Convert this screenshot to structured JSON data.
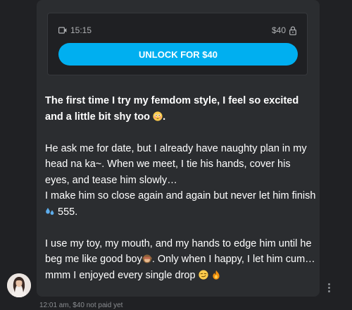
{
  "locked_media": {
    "duration": "15:15",
    "price": "$40",
    "unlock_label": "UNLOCK FOR $40",
    "accent_color": "#00aff0",
    "media_icon": "video-icon",
    "lock_icon": "lock-icon"
  },
  "message": {
    "para1": "The first time I try my femdom style, I feel so excited and a little bit shy too",
    "para1_tail": ".",
    "para2_line1": "He ask me for date, but I already have naughty plan in my head na ka~. When we meet, I tie his hands, cover his eyes, and tease him slowly…",
    "para2_line2": "I make him so close again and again but never let him finish",
    "para2_tail": "555.",
    "para3": "I use my toy, my mouth, and my hands to edge him until he beg me like good boy",
    "para3_mid": ". Only when I happy, I let him cum… mmm I enjoyed every single drop",
    "emojis": [
      "flushed-face-emoji",
      "sweat-droplets-emoji",
      "see-no-evil-monkey-emoji",
      "smirking-face-emoji",
      "fire-emoji"
    ]
  },
  "footer": {
    "time": "12:01 am,",
    "status": "$40 not paid yet"
  }
}
